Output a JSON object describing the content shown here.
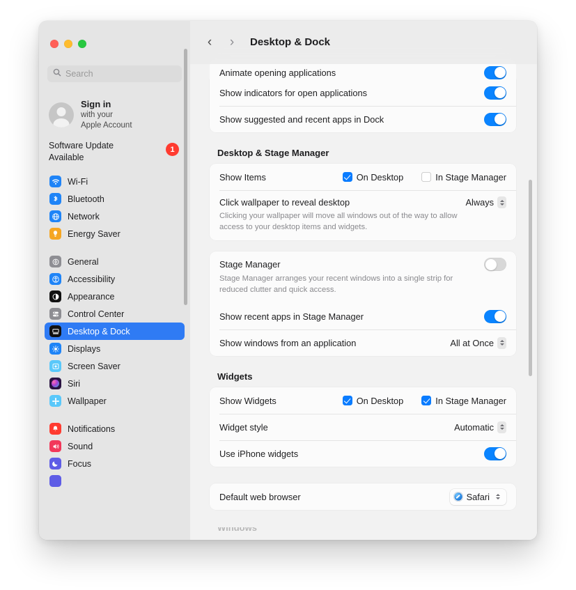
{
  "window": {
    "traffic_lights": [
      "close",
      "minimize",
      "zoom"
    ],
    "title": "Desktop & Dock"
  },
  "sidebar": {
    "search": {
      "placeholder": "Search",
      "icon": "search-icon"
    },
    "account": {
      "title": "Sign in",
      "line2": "with your",
      "line3": "Apple Account",
      "avatar_icon": "person-avatar-icon"
    },
    "software_update": {
      "label": "Software Update Available",
      "badge": "1",
      "badge_color": "#ff3b30"
    },
    "groups": [
      {
        "items": [
          {
            "label": "Wi-Fi",
            "icon": "wifi-icon",
            "color": "#1f84f7"
          },
          {
            "label": "Bluetooth",
            "icon": "bluetooth-icon",
            "color": "#1f84f7"
          },
          {
            "label": "Network",
            "icon": "network-globe-icon",
            "color": "#1f84f7"
          },
          {
            "label": "Energy Saver",
            "icon": "lightbulb-icon",
            "color": "#f5a623"
          }
        ]
      },
      {
        "items": [
          {
            "label": "General",
            "icon": "gear-icon",
            "color": "#8e8e93"
          },
          {
            "label": "Accessibility",
            "icon": "accessibility-icon",
            "color": "#1f84f7"
          },
          {
            "label": "Appearance",
            "icon": "appearance-icon",
            "color": "#111111"
          },
          {
            "label": "Control Center",
            "icon": "control-center-icon",
            "color": "#8e8e93"
          },
          {
            "label": "Desktop & Dock",
            "icon": "desktop-dock-icon",
            "color": "#111111",
            "selected": true
          },
          {
            "label": "Displays",
            "icon": "displays-icon",
            "color": "#1f84f7"
          },
          {
            "label": "Screen Saver",
            "icon": "screen-saver-icon",
            "color": "#5ac8fa"
          },
          {
            "label": "Siri",
            "icon": "siri-icon",
            "color": "#3a1c5c"
          },
          {
            "label": "Wallpaper",
            "icon": "wallpaper-icon",
            "color": "#5ac8fa"
          }
        ]
      },
      {
        "items": [
          {
            "label": "Notifications",
            "icon": "bell-icon",
            "color": "#ff3b30"
          },
          {
            "label": "Sound",
            "icon": "speaker-icon",
            "color": "#f2385a"
          },
          {
            "label": "Focus",
            "icon": "moon-icon",
            "color": "#5e5ce6"
          }
        ]
      }
    ],
    "selected_accent": "#2f7bf4"
  },
  "toolbar": {
    "back_label": "‹",
    "forward_label": "›",
    "title": "Desktop & Dock"
  },
  "main": {
    "dock_card": {
      "clipped_row": {
        "label": "Animate opening applications",
        "toggle": "on"
      },
      "rows": [
        {
          "label": "Show indicators for open applications",
          "toggle": "on"
        },
        {
          "label": "Show suggested and recent apps in Dock",
          "toggle": "on"
        }
      ]
    },
    "sections": [
      {
        "title": "Desktop & Stage Manager",
        "cards": [
          {
            "rows": [
              {
                "type": "checkboxes",
                "label": "Show Items",
                "checkboxes": [
                  {
                    "label": "On Desktop",
                    "checked": true
                  },
                  {
                    "label": "In Stage Manager",
                    "checked": false
                  }
                ]
              },
              {
                "type": "popup-desc",
                "label": "Click wallpaper to reveal desktop",
                "value": "Always",
                "description": "Clicking your wallpaper will move all windows out of the way to allow access to your desktop items and widgets."
              }
            ]
          },
          {
            "rows": [
              {
                "type": "toggle-desc",
                "label": "Stage Manager",
                "toggle": "off",
                "description": "Stage Manager arranges your recent windows into a single strip for reduced clutter and quick access."
              },
              {
                "type": "toggle",
                "label": "Show recent apps in Stage Manager",
                "toggle": "on"
              },
              {
                "type": "popup",
                "label": "Show windows from an application",
                "value": "All at Once"
              }
            ]
          }
        ]
      },
      {
        "title": "Widgets",
        "cards": [
          {
            "rows": [
              {
                "type": "checkboxes",
                "label": "Show Widgets",
                "checkboxes": [
                  {
                    "label": "On Desktop",
                    "checked": true
                  },
                  {
                    "label": "In Stage Manager",
                    "checked": true
                  }
                ]
              },
              {
                "type": "popup",
                "label": "Widget style",
                "value": "Automatic"
              },
              {
                "type": "toggle",
                "label": "Use iPhone widgets",
                "toggle": "on"
              }
            ]
          }
        ]
      },
      {
        "title": "",
        "cards": [
          {
            "rows": [
              {
                "type": "popup-boxed",
                "label": "Default web browser",
                "value": "Safari",
                "icon": "safari-icon"
              }
            ]
          }
        ]
      }
    ],
    "clipped_bottom_title": "Windows"
  },
  "colors": {
    "accent_blue": "#0a84ff",
    "selected_blue": "#2f7bf4",
    "badge_red": "#ff3b30",
    "window_bg": "#f2f2f2",
    "sidebar_bg": "#e5e5e5"
  }
}
